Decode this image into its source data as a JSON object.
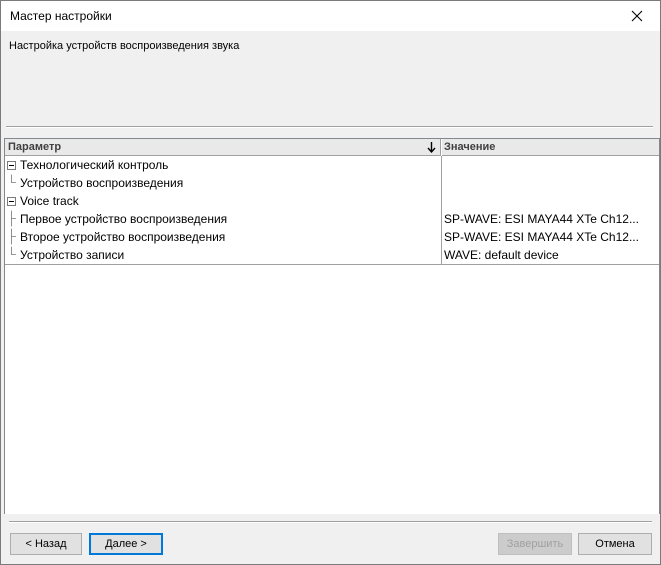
{
  "window": {
    "title": "Мастер настройки"
  },
  "header": {
    "description": "Настройка устройств воспроизведения звука"
  },
  "grid": {
    "columns": {
      "param": "Параметр",
      "value": "Значение"
    },
    "rows": [
      {
        "name": "Технологический контроль",
        "value": "",
        "level": 0,
        "expanded": true
      },
      {
        "name": "Устройство воспроизведения",
        "value": "",
        "level": 1
      },
      {
        "name": "Voice track",
        "value": "",
        "level": 0,
        "expanded": true
      },
      {
        "name": "Первое устройство воспроизведения",
        "value": "SP-WAVE: ESI MAYA44 XTe Ch12...",
        "level": 1
      },
      {
        "name": "Второе устройство воспроизведения",
        "value": "SP-WAVE: ESI MAYA44 XTe Ch12...",
        "level": 1
      },
      {
        "name": "Устройство записи",
        "value": "WAVE: default device",
        "level": 1
      }
    ]
  },
  "buttons": {
    "back": "< Назад",
    "next": "Далее >",
    "finish": "Завершить",
    "cancel": "Отмена"
  },
  "icons": {
    "close": "close-icon",
    "sort": "sort-down-arrow-icon",
    "expander": "tree-minus-icon"
  }
}
